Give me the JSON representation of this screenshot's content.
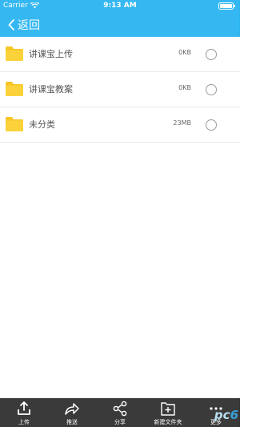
{
  "status_bar": {
    "carrier": "Carrier",
    "time": "9:13 AM"
  },
  "nav": {
    "back_label": "返回"
  },
  "folders": [
    {
      "name": "讲课宝上传",
      "size": "0KB"
    },
    {
      "name": "讲课宝教案",
      "size": "0KB"
    },
    {
      "name": "未分类",
      "size": "23MB"
    }
  ],
  "toolbar": {
    "upload": "上传",
    "push": "推送",
    "share": "分享",
    "new_folder": "新建文件夹",
    "more": "更多"
  },
  "watermark": {
    "text_a": "pc",
    "text_b": "6"
  },
  "colors": {
    "header": "#35b8f1",
    "folder": "#f7c624",
    "toolbar": "#3a3a3a"
  }
}
